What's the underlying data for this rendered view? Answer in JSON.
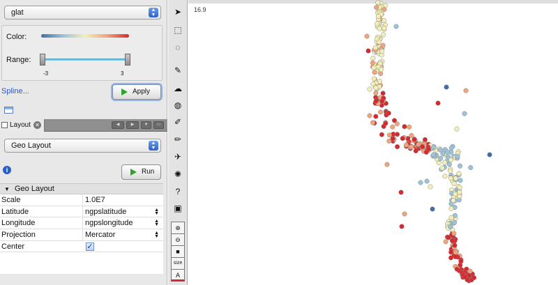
{
  "colormap": {
    "field": "glat",
    "color_label": "Color:",
    "range_label": "Range:",
    "range_min": "-3",
    "range_max": "3",
    "gradient": [
      "#3f6ea8",
      "#9cc3d8",
      "#f3efb7",
      "#f0a47b",
      "#d7282c"
    ]
  },
  "spline_link": "Spline...",
  "apply_label": "Apply",
  "tab": {
    "label": "Layout"
  },
  "layout": {
    "selected": "Geo Layout",
    "run_label": "Run"
  },
  "properties": {
    "header": "Geo Layout",
    "rows": [
      {
        "key": "Scale",
        "value": "1.0E7"
      },
      {
        "key": "Latitude",
        "value": "ngpslatitude"
      },
      {
        "key": "Longitude",
        "value": "ngpslongitude"
      },
      {
        "key": "Projection",
        "value": "Mercator"
      },
      {
        "key": "Center",
        "checked": true
      }
    ]
  },
  "toolbar": {
    "tools": [
      "select-arrow-icon",
      "rect-select-icon",
      "lasso-icon",
      "pen-icon",
      "zoom-cloud-icon",
      "palette-icon",
      "brush-icon",
      "pencil-icon",
      "airplane-icon",
      "gear-icon",
      "cursor-help-icon",
      "node-icon",
      "zoom-in-icon",
      "zoom-out-icon",
      "square-icon",
      "size-icon",
      "text-color-icon"
    ],
    "size_label": "size",
    "text_label": "A"
  },
  "canvas": {
    "scale_text": "16.9"
  }
}
